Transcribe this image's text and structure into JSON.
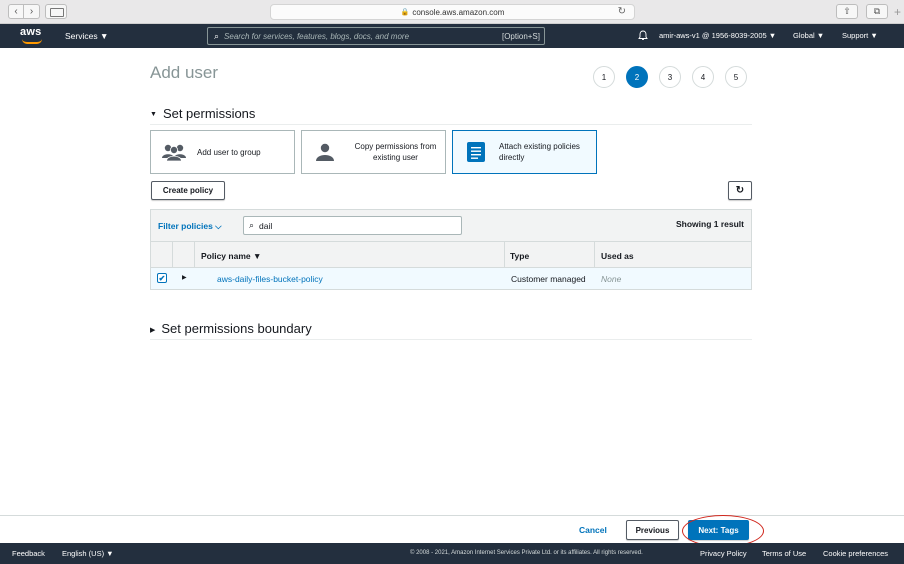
{
  "browser": {
    "url": "console.aws.amazon.com"
  },
  "nav": {
    "logo": "aws",
    "services": "Services ▼",
    "search_placeholder": "Search for services, features, blogs, docs, and more",
    "search_shortcut": "[Option+S]",
    "account": "amir-aws-v1 @ 1956-8039-2005 ▼",
    "region": "Global ▼",
    "support": "Support ▼"
  },
  "page": {
    "title": "Add user",
    "steps": [
      "1",
      "2",
      "3",
      "4",
      "5"
    ],
    "active_step": "2"
  },
  "permissions": {
    "heading": "Set permissions",
    "options": [
      {
        "label": "Add user to group",
        "icon": "group-icon"
      },
      {
        "label": "Copy permissions from existing user",
        "icon": "user-icon"
      },
      {
        "label": "Attach existing policies directly",
        "icon": "document-icon",
        "selected": true
      }
    ],
    "create_policy": "Create policy",
    "refresh_icon": "refresh-icon"
  },
  "table": {
    "filter_label": "Filter policies ⌵",
    "search_value": "dail",
    "count": "Showing 1 result",
    "columns": [
      "Policy name ▼",
      "Type",
      "Used as"
    ],
    "rows": [
      {
        "checked": true,
        "name": "aws-daily-files-bucket-policy",
        "type": "Customer managed",
        "used_as": "None"
      }
    ]
  },
  "boundary": {
    "heading": "Set permissions boundary"
  },
  "actions": {
    "cancel": "Cancel",
    "previous": "Previous",
    "next": "Next: Tags"
  },
  "footer": {
    "feedback": "Feedback",
    "language": "English (US) ▼",
    "copyright": "© 2008 - 2021, Amazon Internet Services Private Ltd. or its affiliates. All rights reserved.",
    "privacy": "Privacy Policy",
    "terms": "Terms of Use",
    "cookies": "Cookie preferences"
  },
  "colors": {
    "nav_bg": "#232f3e",
    "accent": "#0073bb",
    "orange": "#ff9900",
    "annotation_red": "#d0271d"
  }
}
